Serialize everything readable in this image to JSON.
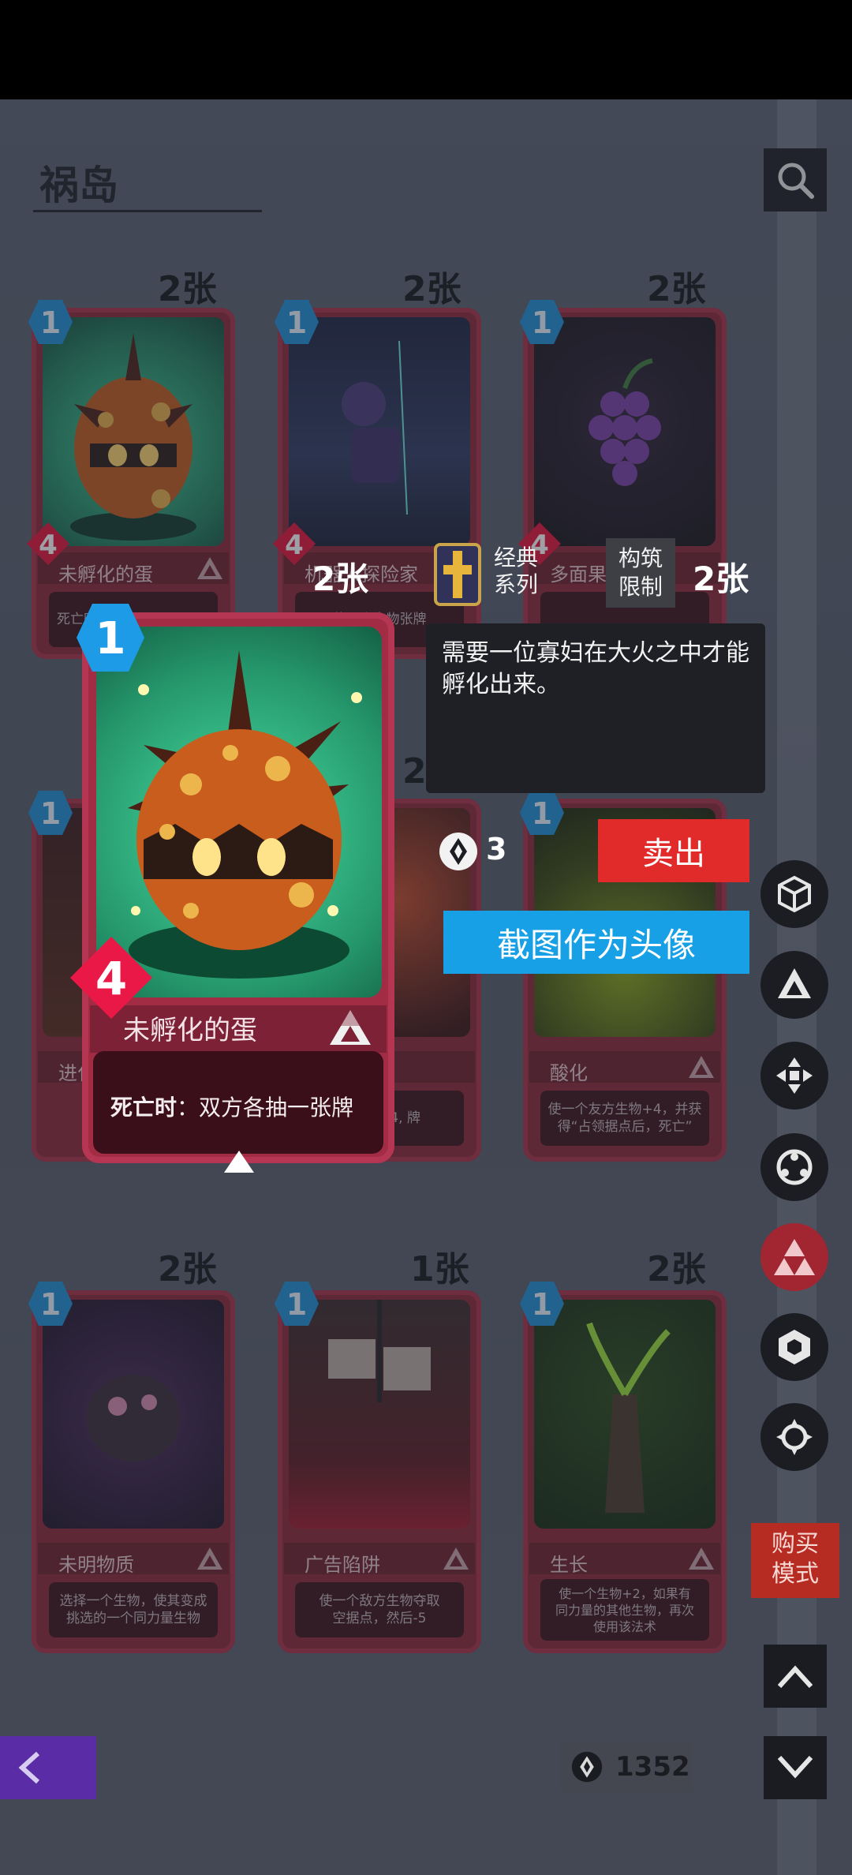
{
  "page": {
    "title": "祸岛"
  },
  "cards_row1": [
    {
      "count": "2张",
      "name": "未孵化的蛋",
      "cost": "1",
      "attack": "4",
      "desc": "死亡时"
    },
    {
      "count": "2张",
      "name": "机器人探险家",
      "cost": "1",
      "attack": "4",
      "desc": "使一个生物张牌"
    },
    {
      "count": "2张",
      "name": "多面果",
      "cost": "1",
      "attack": "4",
      "desc": ""
    }
  ],
  "cards_row2": [
    {
      "count": "",
      "name": "进化",
      "cost": "1",
      "desc": ""
    },
    {
      "count": "2",
      "name": "",
      "cost": "",
      "desc": "个生物+4, 牌"
    },
    {
      "count": "",
      "name": "酸化",
      "cost": "1",
      "desc": "使一个友方生物+4，并获得“占领据点后，死亡”"
    }
  ],
  "cards_row3": [
    {
      "count": "2张",
      "name": "未明物质",
      "cost": "1",
      "desc_lines": [
        "选择一个生物，使其变成",
        "挑选的一个同力量生物"
      ]
    },
    {
      "count": "1张",
      "name": "广告陷阱",
      "cost": "1",
      "desc_lines": [
        "使一个敌方生物夺取",
        "空据点，然后-5"
      ]
    },
    {
      "count": "2张",
      "name": "生长",
      "cost": "1",
      "desc_lines": [
        "使一个生物+2，如果有",
        "同力量的其他生物，再次",
        "使用该法术"
      ]
    }
  ],
  "detail": {
    "cost": "1",
    "attack": "4",
    "name": "未孵化的蛋",
    "desc_keyword": "死亡时",
    "desc_rest": "：双方各抽一张牌",
    "owned_count": "2张",
    "series": "经典\n系列",
    "series_line1": "经典",
    "series_line2": "系列",
    "build_limit_line1": "构筑",
    "build_limit_line2": "限制",
    "build_limit_count": "2张",
    "flavor": "需要一位寡妇在大火之中才能孵化出来。",
    "dust_value": "3",
    "sell_label": "卖出",
    "avatar_label": "截图作为头像"
  },
  "sidebar": {
    "buy_mode_line1": "购买",
    "buy_mode_line2": "模式",
    "icons": [
      "cube-icon",
      "triangles-icon",
      "arrows-icon",
      "circle-dots-icon",
      "triforce-icon",
      "hexagon-icon",
      "gear-icon"
    ]
  },
  "footer": {
    "currency": "1352"
  },
  "colors": {
    "card_red": "#a22c44",
    "sell_red": "#e12a2a",
    "avatar_blue": "#17a0e6",
    "cost_blue": "#1d8fd6",
    "attack_red": "#e6123a"
  }
}
